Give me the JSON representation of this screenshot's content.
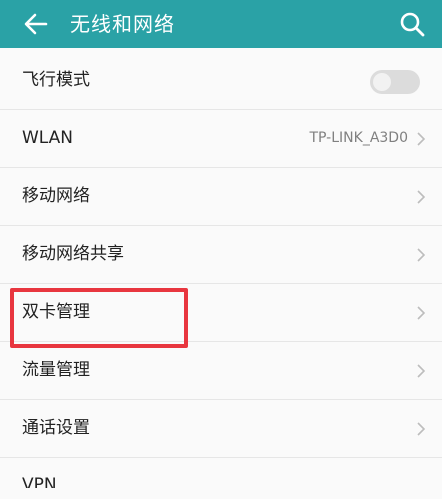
{
  "header": {
    "title": "无线和网络",
    "back_icon": "arrow-left-icon",
    "search_icon": "search-icon",
    "background": "#2aa2a6"
  },
  "settings": {
    "airplane_mode": {
      "label": "飞行模式",
      "toggle_on": false
    },
    "wlan": {
      "label": "WLAN",
      "value": "TP-LINK_A3D0"
    },
    "mobile_network": {
      "label": "移动网络"
    },
    "tethering": {
      "label": "移动网络共享"
    },
    "dual_sim": {
      "label": "双卡管理",
      "highlighted": true
    },
    "data_usage": {
      "label": "流量管理"
    },
    "call_settings": {
      "label": "通话设置"
    },
    "vpn": {
      "label": "VPN"
    }
  },
  "colors": {
    "highlight_border": "#e8363f"
  }
}
